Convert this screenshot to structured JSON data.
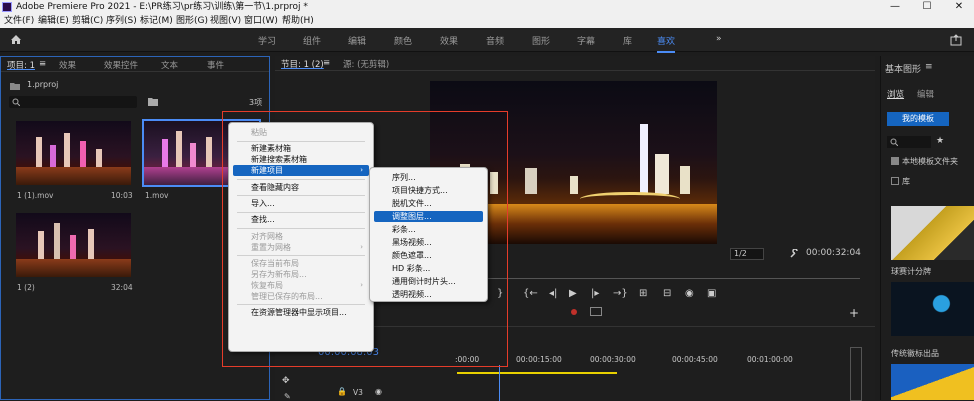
{
  "window": {
    "title": "Adobe Premiere Pro 2021 - E:\\PR练习\\pr练习\\训练\\第一节\\1.prproj *",
    "minimize": "—",
    "maximize": "☐",
    "close": "✕"
  },
  "menu": [
    "文件(F)",
    "编辑(E)",
    "剪辑(C)",
    "序列(S)",
    "标记(M)",
    "图形(G)",
    "视图(V)",
    "窗口(W)",
    "帮助(H)"
  ],
  "workspaces": [
    "学习",
    "组件",
    "编辑",
    "颜色",
    "效果",
    "音频",
    "图形",
    "字幕",
    "库",
    "喜欢"
  ],
  "workspace_active": "喜欢",
  "workspace_more": "»",
  "project": {
    "tabs": [
      "项目: 1",
      "效果",
      "效果控件",
      "文本",
      "事件"
    ],
    "menu_glyph": "≡",
    "file": "1.prproj",
    "count": "3项",
    "items": [
      {
        "name": "1 (1).mov",
        "duration": "10:03"
      },
      {
        "name": "1.mov",
        "duration": ""
      },
      {
        "name": "1 (2)",
        "duration": "32:04"
      }
    ]
  },
  "monitor": {
    "tabs": [
      "节目: 1 (2)",
      "源: (无剪辑)"
    ],
    "menu_glyph": "≡",
    "ratio": "1/2",
    "timecode": "00:00:32:04",
    "add": "+"
  },
  "context_menu": {
    "items": [
      {
        "label": "粘贴",
        "disabled": true
      },
      {
        "sep": true
      },
      {
        "label": "新建素材箱",
        "disabled": false
      },
      {
        "label": "新建搜索素材箱",
        "disabled": false
      },
      {
        "label": "新建项目",
        "disabled": false,
        "highlighted": true,
        "submenu": true
      },
      {
        "sep": true
      },
      {
        "label": "查看隐藏内容",
        "disabled": false
      },
      {
        "sep": true
      },
      {
        "label": "导入...",
        "disabled": false
      },
      {
        "sep": true
      },
      {
        "label": "查找...",
        "disabled": false
      },
      {
        "sep": true
      },
      {
        "label": "对齐网格",
        "disabled": true
      },
      {
        "label": "重置为网格",
        "disabled": true,
        "submenu": true
      },
      {
        "sep": true
      },
      {
        "label": "保存当前布局",
        "disabled": true
      },
      {
        "label": "另存为新布局...",
        "disabled": true
      },
      {
        "label": "恢复布局",
        "disabled": true,
        "submenu": true
      },
      {
        "label": "管理已保存的布局...",
        "disabled": true
      },
      {
        "sep": true
      },
      {
        "label": "在资源管理器中显示项目...",
        "disabled": false
      }
    ],
    "submenu_arrow": "›"
  },
  "submenu": {
    "items": [
      {
        "label": "序列..."
      },
      {
        "label": "项目快捷方式..."
      },
      {
        "label": "脱机文件..."
      },
      {
        "label": "调整图层...",
        "highlighted": true
      },
      {
        "label": "彩条..."
      },
      {
        "label": "黑场视频..."
      },
      {
        "label": "颜色遮罩..."
      },
      {
        "label": "HD 彩条..."
      },
      {
        "label": "通用倒计时片头..."
      },
      {
        "label": "透明视频..."
      }
    ]
  },
  "timeline": {
    "timecode": "00:00:08:03",
    "ruler": [
      ":00:00",
      "00:00:15:00",
      "00:00:30:00",
      "00:00:45:00",
      "00:01:00:00"
    ],
    "track": "V3"
  },
  "essential_graphics": {
    "title": "基本图形",
    "menu_glyph": "≡",
    "tabs": [
      "浏览",
      "编辑"
    ],
    "my_templates": "我的模板",
    "local_templates": "本地模板文件夹",
    "library": "库",
    "templates": [
      {
        "name": "球赛计分牌"
      },
      {
        "name": "传统徽标出品"
      }
    ]
  },
  "colors": {
    "accent": "#4b8cf5",
    "highlight": "#1565c0",
    "annotation": "#e53c2a"
  }
}
